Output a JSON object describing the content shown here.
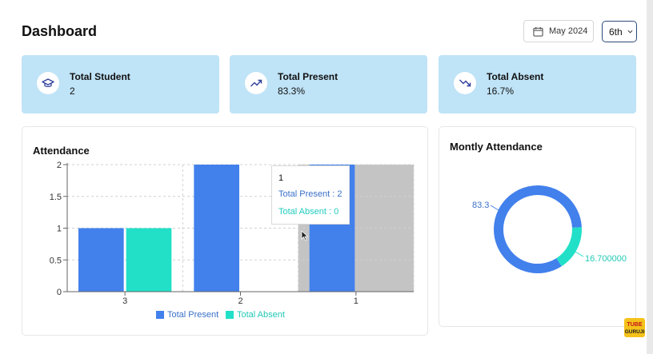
{
  "header": {
    "title": "Dashboard",
    "date_label": "May 2024",
    "class_value": "6th"
  },
  "cards": [
    {
      "label": "Total Student",
      "value": "2",
      "icon": "graduation-cap-icon"
    },
    {
      "label": "Total Present",
      "value": "83.3%",
      "icon": "trending-up-icon"
    },
    {
      "label": "Total Absent",
      "value": "16.7%",
      "icon": "trending-down-icon"
    }
  ],
  "attendance": {
    "title": "Attendance",
    "tooltip": {
      "category": "1",
      "present_line": "Total Present : 2",
      "absent_line": "Total Absent : 0"
    }
  },
  "monthly": {
    "title": "Montly Attendance",
    "label_present": "83.3",
    "label_absent": "16.700000"
  },
  "watermark": {
    "line1": "TUBE",
    "line2": "GURUJI"
  },
  "colors": {
    "present": "#4280ec",
    "absent": "#22e0c8",
    "card_bg": "#bfe3f7",
    "highlight": "#c4c4c4"
  },
  "chart_data": [
    {
      "type": "bar",
      "title": "Attendance",
      "categories": [
        "3",
        "2",
        "1"
      ],
      "series": [
        {
          "name": "Total Present",
          "values": [
            1,
            2,
            2
          ]
        },
        {
          "name": "Total Absent",
          "values": [
            1,
            0,
            0
          ]
        }
      ],
      "yticks": [
        "0",
        "0.5",
        "1",
        "1.5",
        "2"
      ],
      "ylim": [
        0,
        2
      ],
      "grid": true,
      "legend": "bottom"
    },
    {
      "type": "pie",
      "title": "Montly Attendance",
      "labels": [
        "Total Present",
        "Total Absent"
      ],
      "values": [
        83.3,
        16.7
      ],
      "donut": true
    }
  ]
}
